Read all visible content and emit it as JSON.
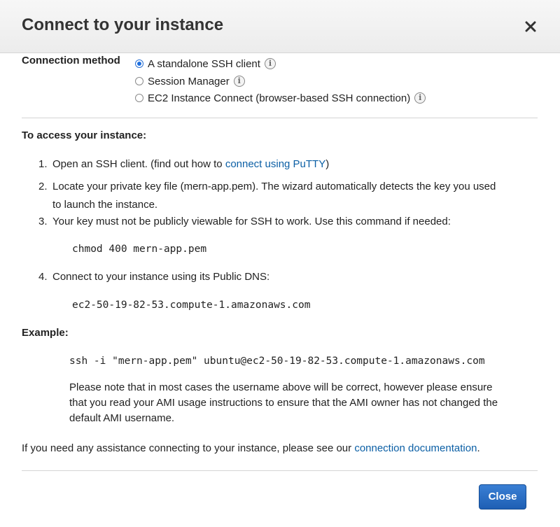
{
  "dialog": {
    "title": "Connect to your instance",
    "close_icon": "close-icon"
  },
  "connection_method": {
    "label": "Connection method",
    "options": [
      {
        "label": "A standalone SSH client",
        "selected": true
      },
      {
        "label": "Session Manager",
        "selected": false
      },
      {
        "label": "EC2 Instance Connect (browser-based SSH connection)",
        "selected": false
      }
    ]
  },
  "access": {
    "title": "To access your instance:",
    "steps": [
      {
        "num": "1.",
        "text_before": "Open an SSH client. (find out how to ",
        "link": "connect using PuTTY",
        "text_after": ")"
      },
      {
        "num": "2.",
        "text_line1": "Locate your private key file (mern-app.pem). The wizard automatically detects the key you used",
        "text_line2": "to launch the instance."
      },
      {
        "num": "3.",
        "text": "Your key must not be publicly viewable for SSH to work. Use this command if needed:"
      },
      {
        "num": "4.",
        "text": "Connect to your instance using its Public DNS:"
      }
    ],
    "chmod_command": "chmod 400 mern-app.pem",
    "public_dns": "ec2-50-19-82-53.compute-1.amazonaws.com"
  },
  "example": {
    "title": "Example:",
    "command": "ssh -i \"mern-app.pem\" ubuntu@ec2-50-19-82-53.compute-1.amazonaws.com",
    "note_line1": "Please note that in most cases the username above will be correct, however please ensure",
    "note_line2": "that you read your AMI usage instructions to ensure that the AMI owner has not changed the",
    "note_line3": "default AMI username."
  },
  "footer": {
    "text_before": "If you need any assistance connecting to your instance, please see our ",
    "link": "connection documentation",
    "text_after": "."
  },
  "buttons": {
    "close_label": "Close"
  },
  "colors": {
    "link": "#0b5fa5",
    "primary_button": "#1e5fb4",
    "header_bg": "#ececec"
  }
}
